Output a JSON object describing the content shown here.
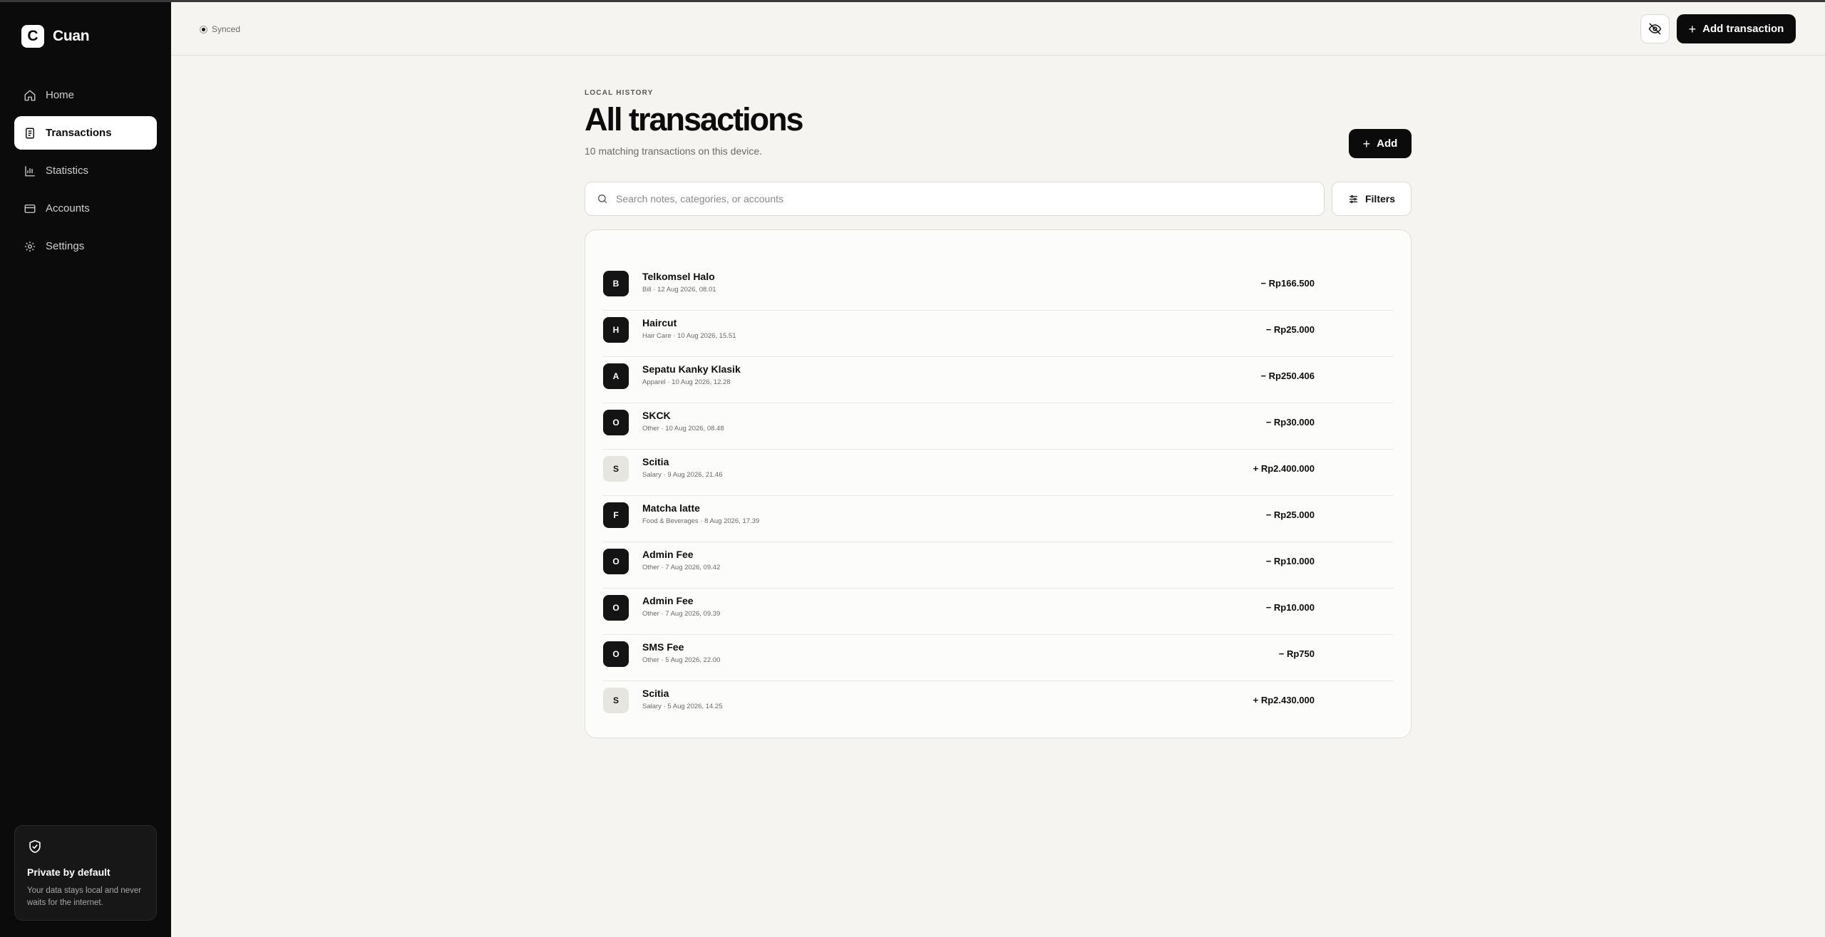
{
  "brand": {
    "logo_letter": "C",
    "name": "Cuan"
  },
  "sidebar": {
    "items": [
      {
        "label": "Home",
        "icon": "home-icon"
      },
      {
        "label": "Transactions",
        "icon": "document-icon",
        "active": true
      },
      {
        "label": "Statistics",
        "icon": "bar-chart-icon"
      },
      {
        "label": "Accounts",
        "icon": "wallet-icon"
      },
      {
        "label": "Settings",
        "icon": "gear-icon"
      }
    ],
    "privacy": {
      "title": "Private by default",
      "text": "Your data stays local and never waits for the internet."
    }
  },
  "topbar": {
    "sync_status": "Synced",
    "add_transaction_label": "Add transaction"
  },
  "main": {
    "eyebrow": "LOCAL HISTORY",
    "title": "All transactions",
    "subtitle": "10 matching transactions on this device.",
    "add_label": "Add",
    "search_placeholder": "Search notes, categories, or accounts",
    "filters_label": "Filters",
    "transactions": [
      {
        "initial": "B",
        "name": "Telkomsel Halo",
        "meta": "Bill · 12 Aug 2026, 08.01",
        "amount": "− Rp166.500",
        "type": "expense"
      },
      {
        "initial": "H",
        "name": "Haircut",
        "meta": "Hair Care · 10 Aug 2026, 15.51",
        "amount": "− Rp25.000",
        "type": "expense"
      },
      {
        "initial": "A",
        "name": "Sepatu Kanky Klasik",
        "meta": "Apparel · 10 Aug 2026, 12.28",
        "amount": "− Rp250.406",
        "type": "expense"
      },
      {
        "initial": "O",
        "name": "SKCK",
        "meta": "Other · 10 Aug 2026, 08.48",
        "amount": "− Rp30.000",
        "type": "expense"
      },
      {
        "initial": "S",
        "name": "Scitia",
        "meta": "Salary · 9 Aug 2026, 21.46",
        "amount": "+ Rp2.400.000",
        "type": "income"
      },
      {
        "initial": "F",
        "name": "Matcha latte",
        "meta": "Food & Beverages · 8 Aug 2026, 17.39",
        "amount": "− Rp25.000",
        "type": "expense"
      },
      {
        "initial": "O",
        "name": "Admin Fee",
        "meta": "Other · 7 Aug 2026, 09.42",
        "amount": "− Rp10.000",
        "type": "expense"
      },
      {
        "initial": "O",
        "name": "Admin Fee",
        "meta": "Other · 7 Aug 2026, 09.39",
        "amount": "− Rp10.000",
        "type": "expense"
      },
      {
        "initial": "O",
        "name": "SMS Fee",
        "meta": "Other · 5 Aug 2026, 22.00",
        "amount": "− Rp750",
        "type": "expense"
      },
      {
        "initial": "S",
        "name": "Scitia",
        "meta": "Salary · 5 Aug 2026, 14.25",
        "amount": "+ Rp2.430.000",
        "type": "income"
      }
    ]
  }
}
